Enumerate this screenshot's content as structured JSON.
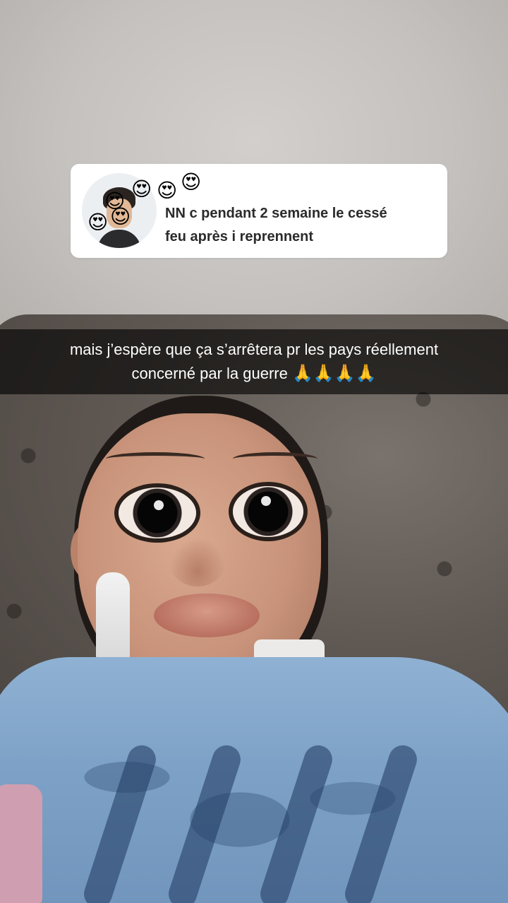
{
  "reply_sticker": {
    "avatar_emojis": [
      "😍",
      "😍",
      "😍",
      "😍",
      "😍"
    ],
    "message": "NN c pendant 2 semaine le cessé feu après i reprennent",
    "message_line1": "NN c pendant 2 semaine le cessé",
    "message_line2": "feu après i reprennent"
  },
  "caption": {
    "line1": "mais j’espère que ça s’arrêtera pr les pays réellement",
    "line2": "concerné par la guerre",
    "emojis": "🙏🙏🙏🙏"
  },
  "colors": {
    "caption_bg": "#000000",
    "caption_text": "#ffffff",
    "card_bg": "#ffffff",
    "card_text": "#2b2b2b"
  }
}
